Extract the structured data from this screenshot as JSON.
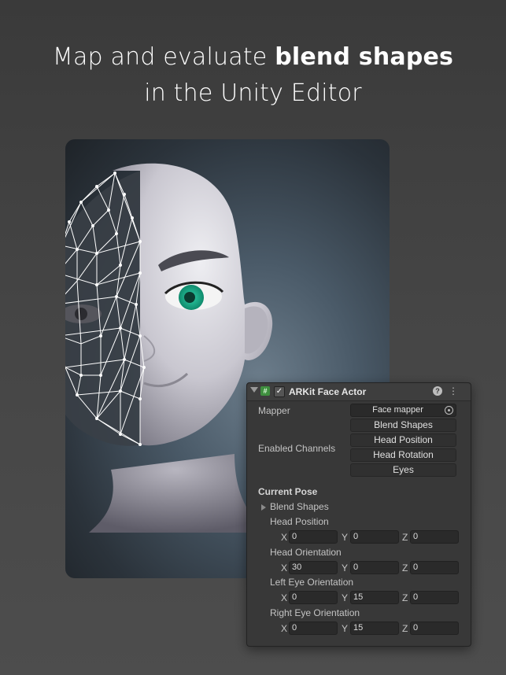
{
  "headline": {
    "line1_pre": "Map and evaluate ",
    "line1_bold": "blend shapes",
    "line2": "in the Unity Editor"
  },
  "inspector": {
    "title": "ARKit Face Actor",
    "script_icon": "#",
    "enabled_check": "✓",
    "help_glyph": "?",
    "menu_glyph": "⋮",
    "mapper_label": "Mapper",
    "mapper_value": "Face mapper",
    "enabled_channels_label": "Enabled Channels",
    "channels": [
      "Blend Shapes",
      "Head Position",
      "Head Rotation",
      "Eyes"
    ],
    "current_pose_label": "Current Pose",
    "blend_shapes_foldout": "Blend Shapes",
    "groups": [
      {
        "label": "Head Position",
        "x": "0",
        "y": "0",
        "z": "0"
      },
      {
        "label": "Head Orientation",
        "x": "30",
        "y": "0",
        "z": "0"
      },
      {
        "label": "Left Eye Orientation",
        "x": "0",
        "y": "15",
        "z": "0"
      },
      {
        "label": "Right Eye Orientation",
        "x": "0",
        "y": "15",
        "z": "0"
      }
    ],
    "axis_labels": {
      "x": "X",
      "y": "Y",
      "z": "Z"
    }
  },
  "colors": {
    "eye_iris": "#1fae8c",
    "skin": "#d9d7df",
    "panel_bg": "#383838",
    "script_icon": "#3f8f3f"
  }
}
